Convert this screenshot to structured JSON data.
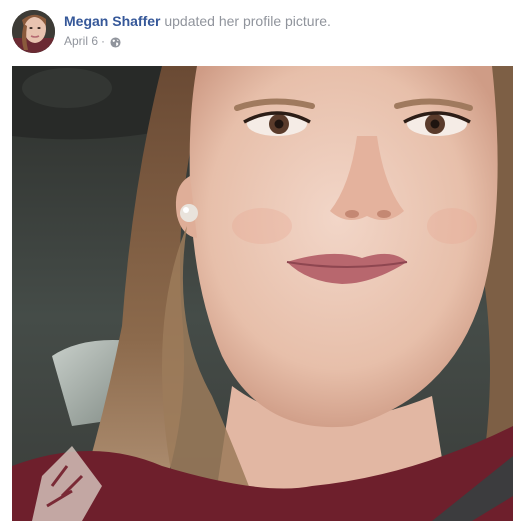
{
  "post": {
    "author_name": "Megan Shaffer",
    "action_text": "updated her profile picture.",
    "date": "April 6",
    "separator": "·",
    "privacy_icon": "globe-icon",
    "photo_subject": "profile-photo"
  },
  "colors": {
    "author_link": "#365899",
    "meta_text": "#90949c",
    "background": "#ffffff"
  }
}
